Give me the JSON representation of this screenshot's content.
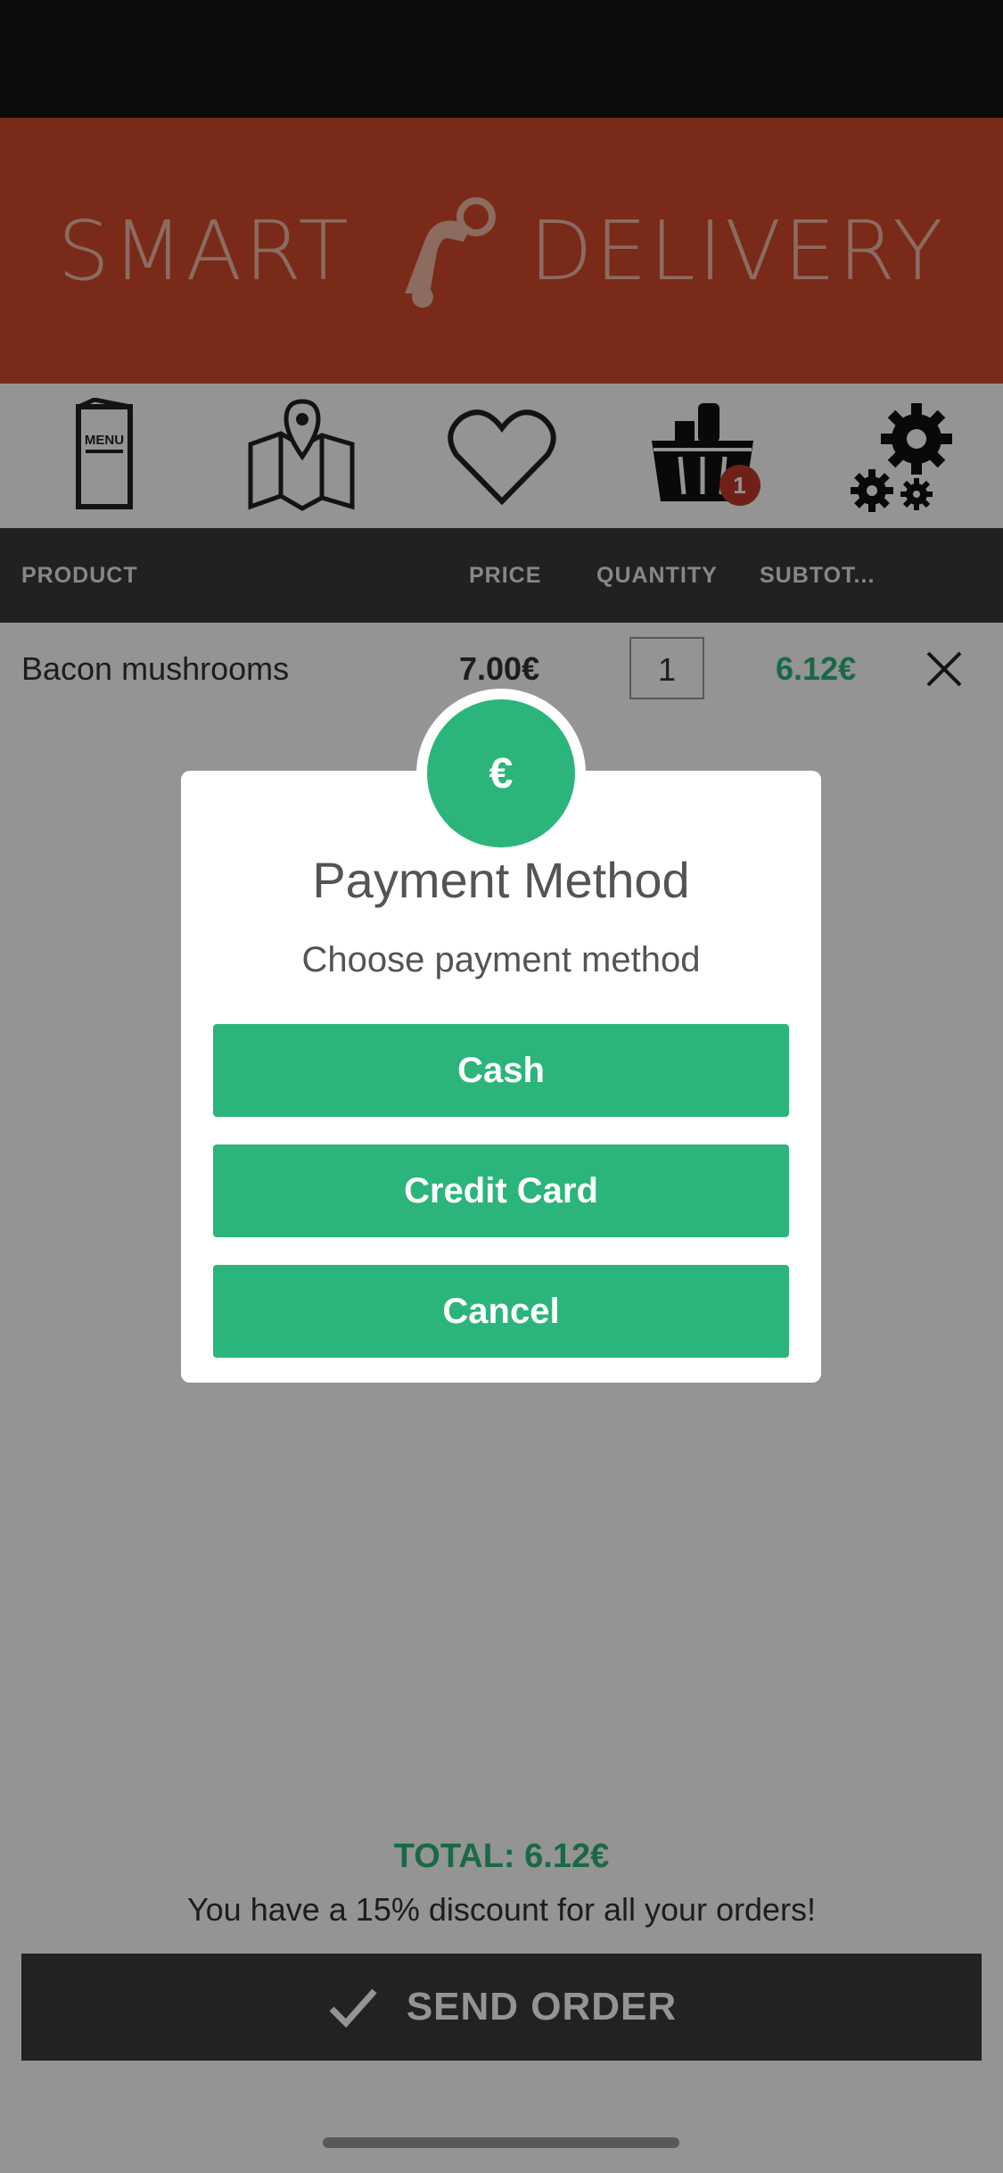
{
  "app": {
    "brand_left": "SMART",
    "brand_right": "DELIVERY",
    "brand_color": "#d3492a",
    "accent": "#2bb57a"
  },
  "nav": [
    {
      "name": "menu-icon",
      "label": "MENU"
    },
    {
      "name": "map-icon"
    },
    {
      "name": "favorites-icon"
    },
    {
      "name": "basket-icon",
      "badge": "1"
    },
    {
      "name": "settings-icon"
    }
  ],
  "table": {
    "headers": [
      "PRODUCT",
      "PRICE",
      "QUANTITY",
      "SUBTOT..."
    ],
    "rows": [
      {
        "product": "Bacon mushrooms",
        "price": "7.00€",
        "quantity": "1",
        "subtotal": "6.12€"
      }
    ]
  },
  "summary": {
    "total": "TOTAL: 6.12€",
    "discount": "You have a 15% discount for all your orders!",
    "send_label": "SEND ORDER"
  },
  "dialog": {
    "badge": "€",
    "title": "Payment Method",
    "subtitle": "Choose payment method",
    "buttons": [
      "Cash",
      "Credit Card",
      "Cancel"
    ]
  }
}
